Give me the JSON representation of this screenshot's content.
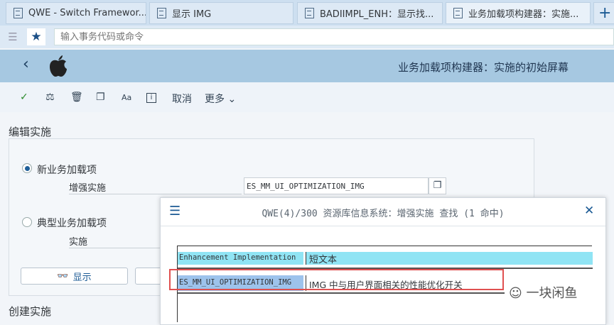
{
  "tabs": [
    {
      "label": "QWE - Switch Framewor..."
    },
    {
      "label": "显示 IMG"
    },
    {
      "label": "BADIIMPL_ENH：显示找..."
    },
    {
      "label": "业务加载项构建器：实施..."
    }
  ],
  "new_tab": "+",
  "command": {
    "placeholder": "输入事务代码或命令"
  },
  "header": {
    "title": "业务加载项构建器：实施的初始屏幕"
  },
  "toolbar": {
    "cancel": "取消",
    "more": "更多"
  },
  "edit_section": {
    "title": "编辑实施",
    "radio_new": "新业务加载项",
    "field_enh_label": "增强实施",
    "field_enh_value": "ES_MM_UI_OPTIMIZATION_IMG",
    "radio_classic": "典型业务加载项",
    "field_impl_label": "实施",
    "display_button": "显示"
  },
  "create_section": {
    "title": "创建实施"
  },
  "popup": {
    "title": "QWE(4)/300 资源库信息系统：增强实施 查找 (1 命中)",
    "columns": [
      "Enhancement Implementation",
      "短文本"
    ],
    "rows": [
      [
        "ES_MM_UI_OPTIMIZATION_IMG",
        "IMG 中与用户界面相关的性能优化开关"
      ]
    ]
  },
  "watermark": "一块闲鱼"
}
